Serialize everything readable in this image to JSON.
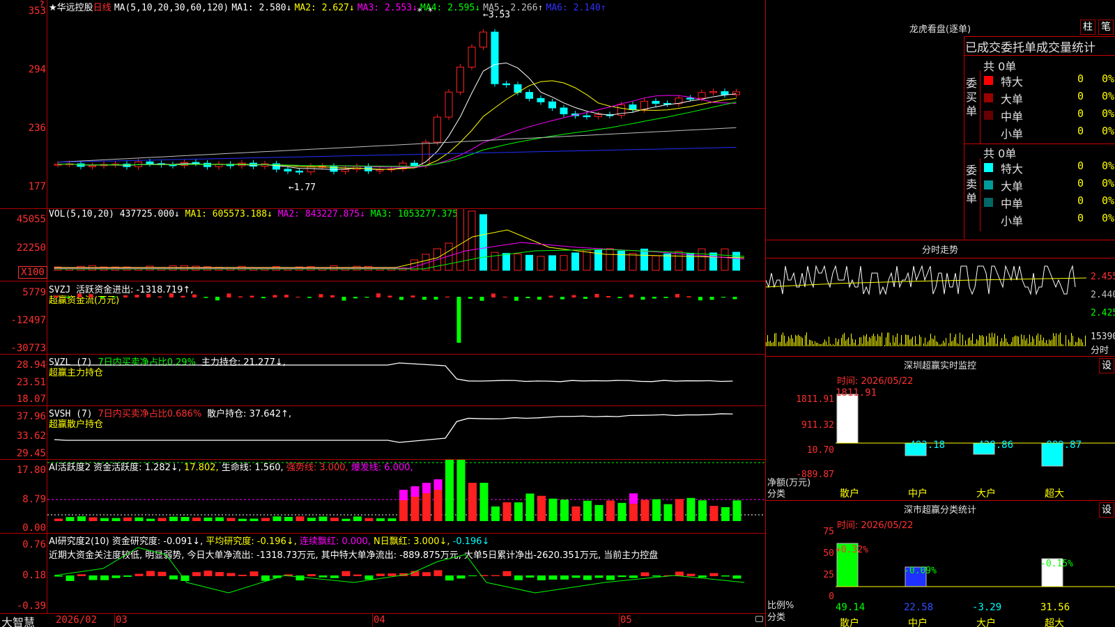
{
  "header": {
    "star": "★",
    "stock_name": "华远控股",
    "period": "日线",
    "ma_params": "MA(5,10,20,30,60,120)",
    "ma1": "MA1: 2.580↓",
    "ma2": "MA2: 2.627↓",
    "ma3": "MA3: 2.553↓",
    "ma4": "MA4: 2.595↓",
    "ma5": "MA5: 2.266↑",
    "ma6": "MA6: 2.140↑",
    "stars": "* *",
    "high_mark": "3.53",
    "low_mark": "1.77",
    "corner_mark": "?"
  },
  "price_axis": [
    "353",
    "294",
    "236",
    "177"
  ],
  "vol": {
    "label": "VOL(5,10,20)",
    "value": "437725.000↓",
    "ma1": "MA1: 605573.188↓",
    "ma2": "MA2: 843227.875↓",
    "ma3": "MA3: 1053277.375↓",
    "axis": [
      "45055",
      "22250"
    ],
    "unit": "X100"
  },
  "svzj": {
    "label": "SVZJ",
    "desc": "活跃资金进出: -1318.719↑,",
    "sub": "超赢资金流(万元)",
    "axis": [
      "5779",
      "-12497",
      "-30773"
    ]
  },
  "svzl": {
    "label": "SVZL (7)",
    "ratio": "7日内买卖净占比0.29%",
    "hold": "主力持仓: 21.277↓,",
    "sub": "超赢主力持仓",
    "axis": [
      "28.94",
      "23.51",
      "18.07"
    ]
  },
  "svsh": {
    "label": "SVSH (7)",
    "ratio": "7日内买卖净占比0.686%",
    "hold": "散户持仓: 37.642↑,",
    "sub": "超赢散户持仓",
    "axis": [
      "37.96",
      "33.62",
      "29.45"
    ]
  },
  "ai_active": {
    "label": "AI活跃度2",
    "active": "资金活跃度: 1.282↓,",
    "v2": "17.802,",
    "life": "生命线: 1.560,",
    "strong": "强势线: 3.000,",
    "burst": "爆发线: 6.000,",
    "axis": [
      "17.80",
      "8.79",
      "0.00"
    ]
  },
  "ai_research": {
    "label": "AI研究度2(10)",
    "research": "资金研究度: -0.091↓,",
    "avg": "平均研究度: -0.196↓,",
    "red": "连续飘红: 0.000,",
    "nred": "N日飘红: 3.000↓,",
    "last": "-0.196↓",
    "comment": "近期大资金关注度较低, 明显弱势, 今日大单净流出: -1318.73万元, 其中特大单净流出: -889.875万元, 大单5日累计净出-2620.351万元, 当前主力控盘",
    "axis": [
      "0.76",
      "0.18",
      "-0.39"
    ]
  },
  "date_axis": {
    "brand": "大智慧",
    "labels": [
      "2026/02",
      "03",
      "04",
      "05"
    ]
  },
  "right": {
    "title": "龙虎看盘(逐单)",
    "btn_pillar": "柱",
    "btn_stroke": "笔",
    "stats_title": "已成交委托单成交量统计",
    "buy_label": "委买单",
    "sell_label": "委卖单",
    "buy_total": "共 0单",
    "sell_total": "共 0单",
    "buy_rows": [
      {
        "name": "特大",
        "count": "0",
        "pct": "0%",
        "color": "#ff0000"
      },
      {
        "name": "大单",
        "count": "0",
        "pct": "0%",
        "color": "#9a0000"
      },
      {
        "name": "中单",
        "count": "0",
        "pct": "0%",
        "color": "#660000"
      },
      {
        "name": "小单",
        "count": "0",
        "pct": "0%",
        "color": "#000000"
      }
    ],
    "sell_rows": [
      {
        "name": "特大",
        "count": "0",
        "pct": "0%",
        "color": "#00ffff"
      },
      {
        "name": "大单",
        "count": "0",
        "pct": "0%",
        "color": "#009a9a"
      },
      {
        "name": "中单",
        "count": "0",
        "pct": "0%",
        "color": "#006666"
      },
      {
        "name": "小单",
        "count": "0",
        "pct": "0%",
        "color": "#000000"
      }
    ],
    "intraday_title": "分时走势",
    "intraday_axis": [
      "2.455",
      "2.440",
      "2.425"
    ],
    "intraday_vol": "15390",
    "intraday_vol_unit": "分时",
    "sz_monitor": {
      "title": "深圳超赢实时监控",
      "btn": "设",
      "time": "时间: 2026/05/22",
      "axis": [
        "1811.91",
        "911.32",
        "10.70",
        "-889.87"
      ],
      "values": [
        "1811.91",
        "-493.18",
        "-428.86",
        "-889.87"
      ],
      "cats": [
        "散户",
        "中户",
        "大户",
        "超大"
      ],
      "ylabel": "净额(万元)",
      "xlabel": "分类"
    },
    "sz_class": {
      "title": "深市超赢分类统计",
      "btn": "设",
      "time": "时间: 2026/05/22",
      "axis": [
        "75",
        "50",
        "25",
        "0"
      ],
      "pct_top": [
        "+0.32%",
        "-0.09%",
        "",
        "-0.15%"
      ],
      "values": [
        "49.14",
        "22.58",
        "-3.29",
        "31.56"
      ],
      "cats": [
        "散户",
        "中户",
        "大户",
        "超大"
      ],
      "ylabel": "比例%",
      "xlabel": "分类"
    }
  },
  "colors": {
    "up": "#ff2020",
    "down": "#00ffff",
    "grid": "#b00000",
    "yellow": "#ffff00",
    "magenta": "#ff00ff",
    "green": "#00ff00"
  }
}
